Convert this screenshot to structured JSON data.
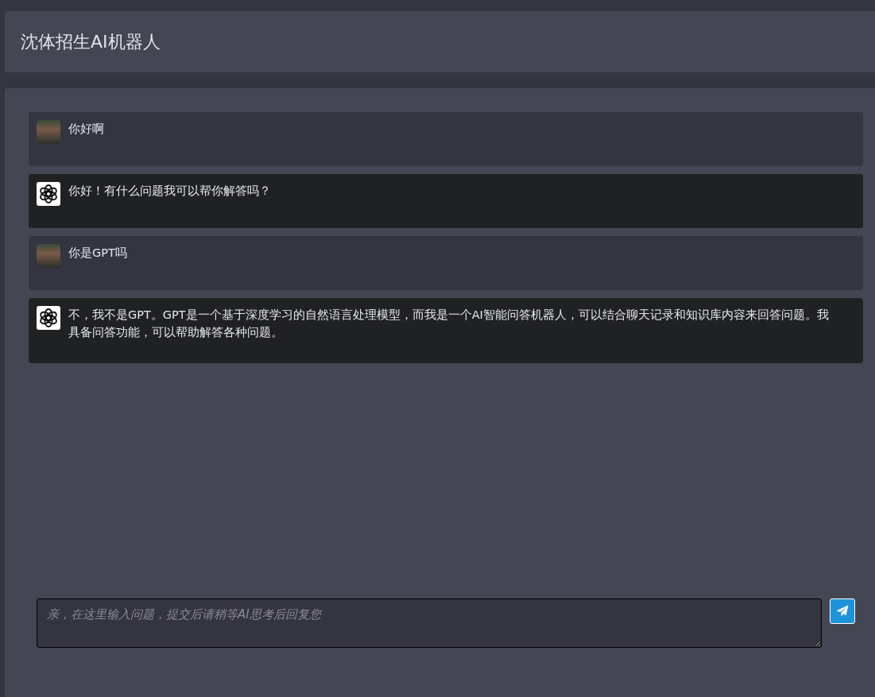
{
  "header": {
    "title": "沈体招生AI机器人"
  },
  "messages": [
    {
      "kind": "user",
      "text": "你好啊"
    },
    {
      "kind": "bot",
      "text": "你好！有什么问题我可以帮你解答吗？"
    },
    {
      "kind": "user",
      "text": "你是GPT吗"
    },
    {
      "kind": "bot",
      "text": "不，我不是GPT。GPT是一个基于深度学习的自然语言处理模型，而我是一个AI智能问答机器人，可以结合聊天记录和知识库内容来回答问题。我具备问答功能，可以帮助解答各种问题。"
    }
  ],
  "input": {
    "placeholder": "亲，在这里输入问题，提交后请稍等AI思考后回复您"
  }
}
